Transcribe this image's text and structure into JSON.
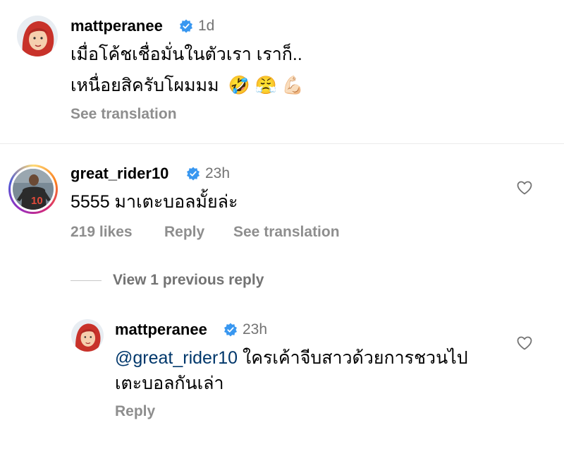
{
  "comments": [
    {
      "username": "mattperanee",
      "time": "1d",
      "text_line1": "เมื่อโค้ชเชื่อมั่นในตัวเรา เราก็..",
      "text_line2": "เหนื่อยสิครับโผมมม",
      "emojis": [
        "🤣",
        "😤",
        "💪🏻"
      ],
      "see_translation": "See translation"
    },
    {
      "username": "great_rider10",
      "time": "23h",
      "text": "5555 มาเตะบอลมั้ยล่ะ",
      "avatar_jersey_number": "10",
      "likes": "219 likes",
      "reply": "Reply",
      "see_translation": "See translation",
      "view_replies": "View 1 previous reply",
      "replies": [
        {
          "username": "mattperanee",
          "time": "23h",
          "mention": "@great_rider10",
          "text_line1": " ใครเค้าจีบสาวด้วยการชวนไป",
          "text_line2": "เตะบอลกันเล่า",
          "reply": "Reply"
        }
      ]
    }
  ],
  "colors": {
    "verified": "#3897f0",
    "meta_gray": "#8e8e8e",
    "mention": "#00376b",
    "story_ring": [
      "#feda75",
      "#d62976",
      "#962fbf"
    ]
  }
}
